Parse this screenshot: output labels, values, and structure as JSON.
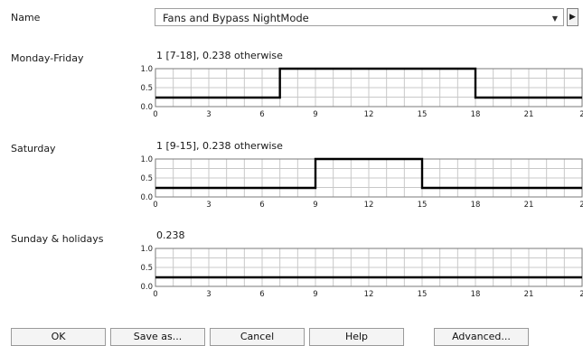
{
  "name_row": {
    "label": "Name",
    "value": "Fans and Bypass NightMode",
    "dropdown_icon": "chevron-down-icon",
    "next_icon": "play-right-icon"
  },
  "schedules": [
    {
      "label": "Monday-Friday",
      "summary": "1 [7-18], 0.238 otherwise",
      "on_start": 7,
      "on_end": 18,
      "on_value": 1,
      "off_value": 0.238
    },
    {
      "label": "Saturday",
      "summary": "1 [9-15], 0.238 otherwise",
      "on_start": 9,
      "on_end": 15,
      "on_value": 1,
      "off_value": 0.238
    },
    {
      "label": "Sunday & holidays",
      "summary": "0.238",
      "on_start": null,
      "on_end": null,
      "on_value": null,
      "off_value": 0.238
    }
  ],
  "chart_axes": {
    "y_ticks": [
      "1.0",
      "0.5",
      "0.0"
    ],
    "x_ticks": [
      "0",
      "3",
      "6",
      "9",
      "12",
      "15",
      "18",
      "21",
      "2"
    ],
    "x_min": 0,
    "x_max": 24,
    "y_min": 0,
    "y_max": 1
  },
  "buttons": {
    "ok": "OK",
    "save_as": "Save as...",
    "cancel": "Cancel",
    "help": "Help",
    "advanced": "Advanced..."
  },
  "colors": {
    "line": "#000000",
    "grid": "#c8c8c8",
    "frame": "#7a7a7a"
  }
}
